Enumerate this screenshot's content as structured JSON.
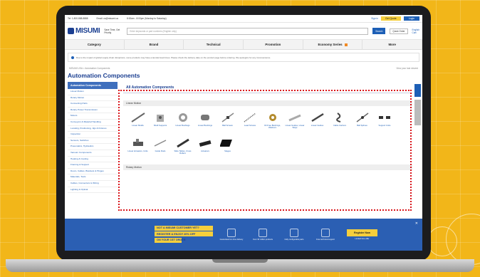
{
  "topbar": {
    "phone": "Tel: 1-800-888-8888",
    "email": "Email: cs@misumi.us",
    "hours": "8:00am - 8:00pm (Monday to Saturday)",
    "wos_label": "Sign in",
    "quote_btn": "Get Quote",
    "login_btn": "Login"
  },
  "header": {
    "logo": "MISUMI",
    "tagline": "Save Time, Get Priority",
    "search_placeholder": "Enter keywords or part numbers (English only)",
    "search_btn": "Search",
    "quick_order": "Quick Order",
    "lang": "English",
    "cart": "Cart"
  },
  "nav": [
    "Category",
    "Brand",
    "Technical",
    "Promotion",
    "Economy Series",
    "More"
  ],
  "notice": "Due to the impact of global supply chain disruptions, some products may have extended lead times. Please check the delivery date on the product page before ordering. We apologize for any inconvenience.",
  "breadcrumb": {
    "path": "MISUMI USA  >  Automation Components",
    "right": "View your last viewed"
  },
  "page_title": "Automation Components",
  "sidebar": {
    "head": "Automation Components",
    "items": [
      "Linear Motion",
      "Rotary Motion",
      "Connecting Parts",
      "Rotary Power Transmission",
      "Motors",
      "Conveyors & Material Handling",
      "Locating, Positioning, Jigs & Fixtures",
      "Inspection",
      "Sensors, Switches",
      "Pneumatics, Hydraulics",
      "Vacuum Components",
      "Heating & Cooling",
      "Framing & Support",
      "Doors, Cables, Brackets & Hinges",
      "Materials, Tools",
      "Cables, Connectors & Wiring",
      "Lighting & Optical"
    ]
  },
  "main": {
    "heading": "All Automation Components",
    "section1": "Linear Motion",
    "section2": "Rotary Motion",
    "tiles": [
      {
        "label": "Linear Shafts",
        "icon": "shaft-icon"
      },
      {
        "label": "Shaft Supports",
        "icon": "shaft-support-icon"
      },
      {
        "label": "Linear Bushings",
        "icon": "bushing-icon"
      },
      {
        "label": "Linear Bushings",
        "icon": "flange-bushing-icon"
      },
      {
        "label": "Ball Screws",
        "icon": "ball-screw-icon"
      },
      {
        "label": "Lead Screws",
        "icon": "lead-screw-icon"
      },
      {
        "label": "Oil Free Bushings, Washers",
        "icon": "oil-free-bushing-icon"
      },
      {
        "label": "Linear Guides, Linear Ways",
        "icon": "linear-guide-icon"
      },
      {
        "label": "Linear Guides",
        "icon": "rail-guide-icon"
      },
      {
        "label": "Cable Carriers",
        "icon": "cable-carrier-icon"
      },
      {
        "label": "Ball Splines",
        "icon": "ball-spline-icon"
      },
      {
        "label": "Support Units",
        "icon": "support-unit-icon"
      },
      {
        "label": "Linear Actuators, Units",
        "icon": "actuator-icon"
      },
      {
        "label": "Guide Rods",
        "icon": "guide-rod-icon"
      },
      {
        "label": "Slide Tables, Cross Rollers",
        "icon": "slide-table-icon"
      },
      {
        "label": "Actuators",
        "icon": "actuator2-icon"
      },
      {
        "label": "Stages",
        "icon": "stage-icon"
      }
    ]
  },
  "banner": {
    "promo": [
      "NOT A MISUMI CUSTOMER YET?",
      "REGISTER & ENJOY 20% OFF",
      "ON YOUR 1ST ORDER"
    ],
    "features": [
      "Guaranteed on-time delivery",
      "Over 30 million products",
      "Fully configurable parts",
      "Free technical support"
    ],
    "register_btn": "Register Now",
    "register_sub": "Limited time offer"
  }
}
